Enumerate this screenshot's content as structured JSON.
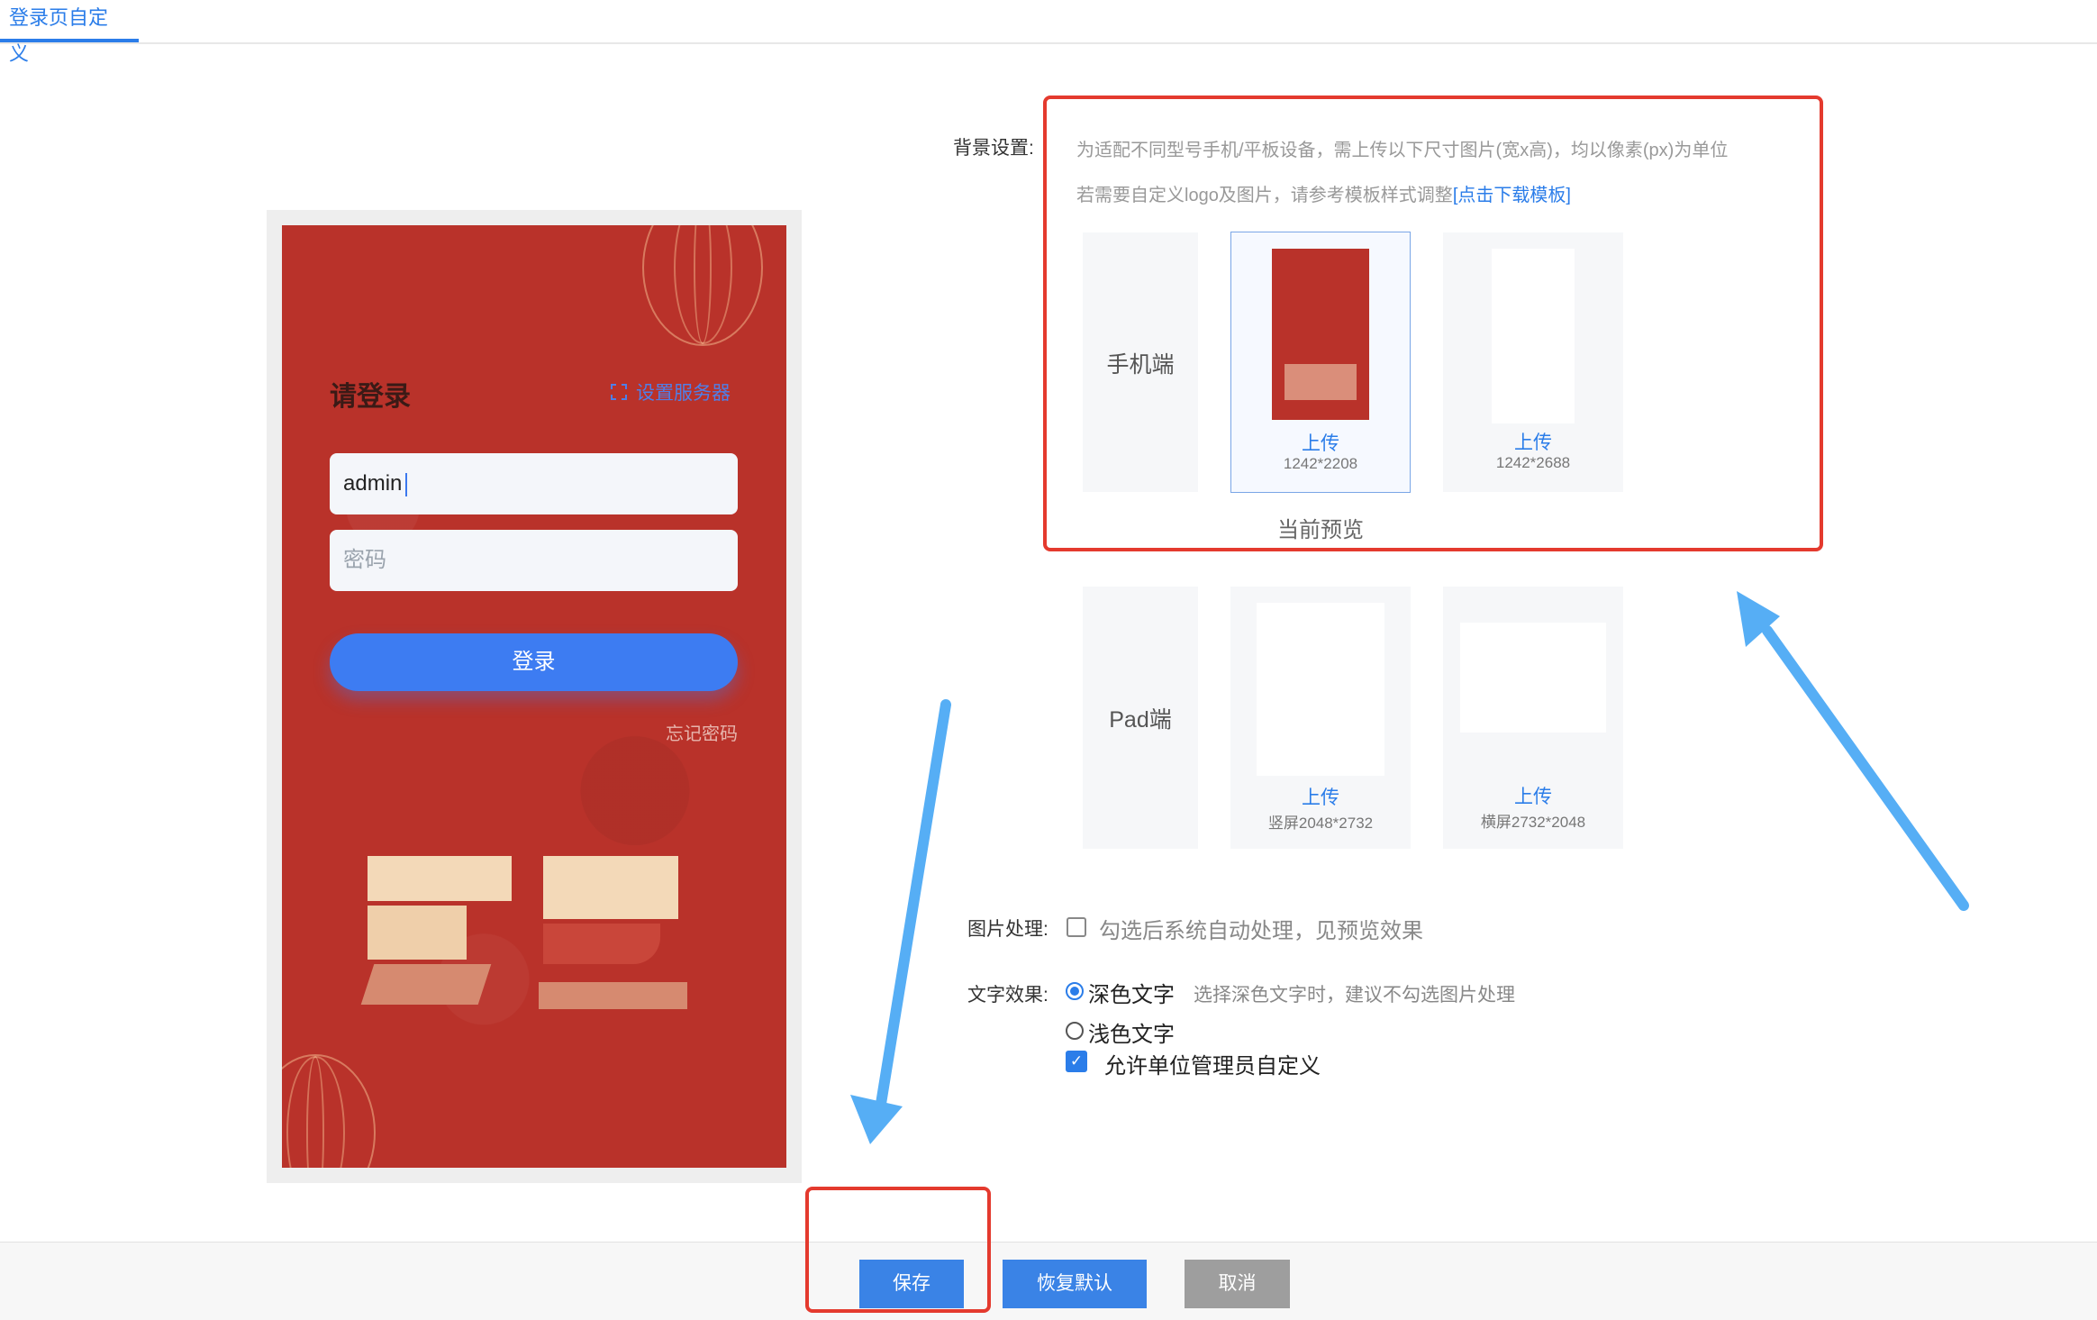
{
  "tabs": [
    {
      "label": "登录页自定义"
    }
  ],
  "preview": {
    "title": "请登录",
    "server_link": "设置服务器",
    "username_value": "admin",
    "password_placeholder": "密码",
    "login_button": "登录",
    "forgot_link": "忘记密码"
  },
  "background": {
    "label": "背景设置:",
    "hint_line1": "为适配不同型号手机/平板设备，需上传以下尺寸图片(宽x高)，均以像素(px)为单位",
    "hint_line2": "若需要自定义logo及图片，请参考模板样式调整",
    "template_link": "[点击下载模板]",
    "mobile": {
      "label": "手机端",
      "items": [
        {
          "upload": "上传",
          "size": "1242*2208"
        },
        {
          "upload": "上传",
          "size": "1242*2688"
        }
      ],
      "current_preview": "当前预览"
    },
    "pad": {
      "label": "Pad端",
      "items": [
        {
          "upload": "上传",
          "size": "竖屏2048*2732"
        },
        {
          "upload": "上传",
          "size": "横屏2732*2048"
        }
      ]
    }
  },
  "image_processing": {
    "label": "图片处理:",
    "text": "勾选后系统自动处理，见预览效果",
    "checked": false
  },
  "text_effect": {
    "label": "文字效果:",
    "dark": "深色文字",
    "dark_hint": "选择深色文字时，建议不勾选图片处理",
    "light": "浅色文字",
    "selected": "dark"
  },
  "allow_custom": {
    "text": "允许单位管理员自定义",
    "checked": true
  },
  "footer": {
    "save": "保存",
    "restore": "恢复默认",
    "cancel": "取消"
  },
  "colors": {
    "accent": "#2b7de9",
    "highlight": "#e43a2e",
    "arrow": "#56aef5",
    "preview_bg": "#b9322a"
  }
}
